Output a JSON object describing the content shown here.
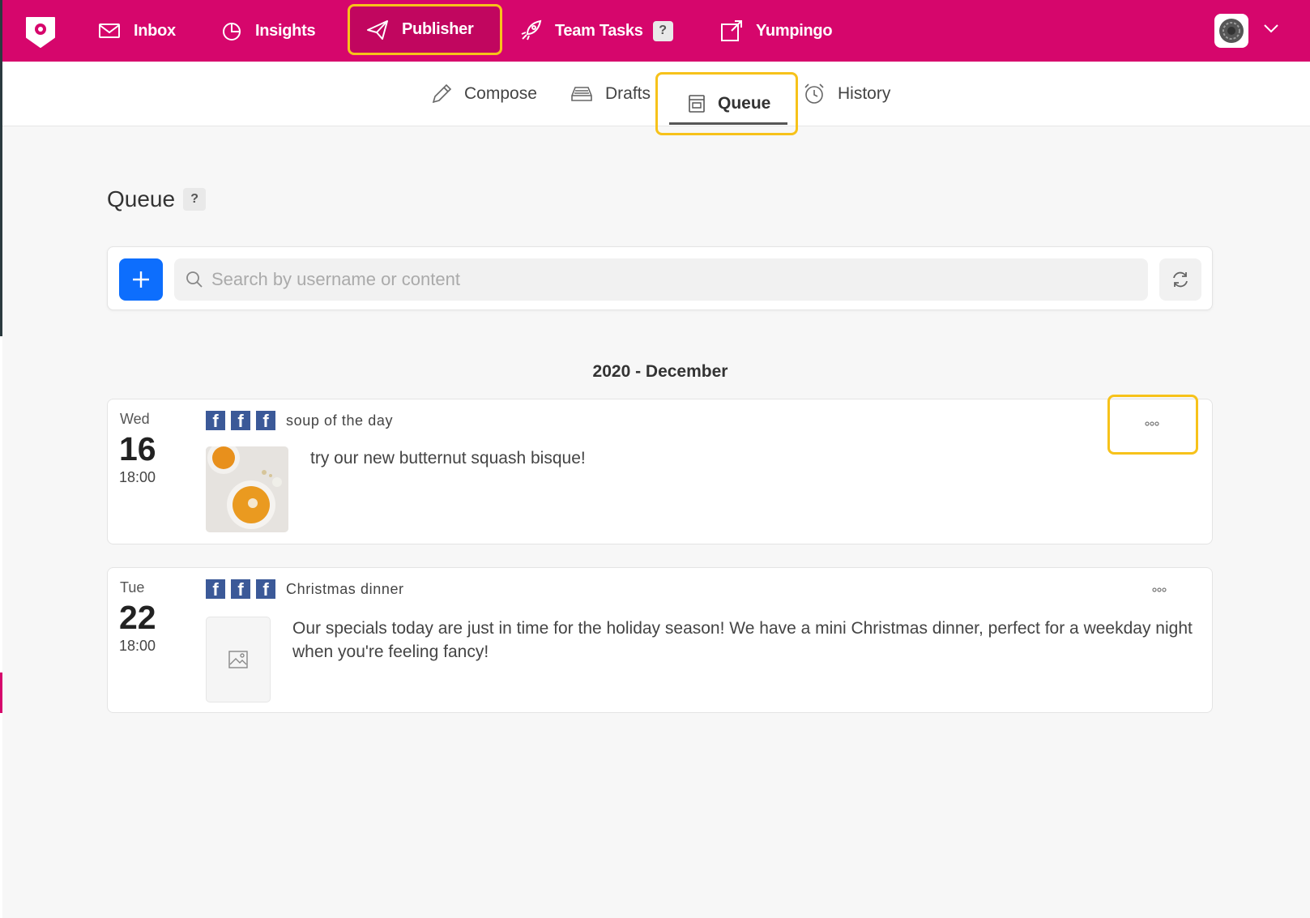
{
  "nav": {
    "items": [
      {
        "label": "Inbox",
        "icon": "mail-icon"
      },
      {
        "label": "Insights",
        "icon": "pie-chart-icon"
      },
      {
        "label": "Publisher",
        "icon": "paper-plane-icon",
        "active": true
      },
      {
        "label": "Team Tasks",
        "icon": "rocket-icon",
        "badge": "?"
      },
      {
        "label": "Yumpingo",
        "icon": "external-link-icon"
      }
    ]
  },
  "subnav": {
    "items": [
      {
        "label": "Compose",
        "icon": "pencil-icon"
      },
      {
        "label": "Drafts",
        "icon": "tray-icon"
      },
      {
        "label": "Queue",
        "icon": "calendar-icon",
        "active": true
      },
      {
        "label": "History",
        "icon": "alarm-clock-icon"
      }
    ]
  },
  "page": {
    "title": "Queue",
    "help": "?"
  },
  "search": {
    "placeholder": "Search by username or content",
    "value": ""
  },
  "queue": {
    "month_header": "2020 - December",
    "posts": [
      {
        "day": "Wed",
        "date": "16",
        "time": "18:00",
        "networks": [
          "facebook",
          "facebook",
          "facebook"
        ],
        "title": "soup of the day",
        "text": "try our new butternut squash bisque!",
        "has_image": true
      },
      {
        "day": "Tue",
        "date": "22",
        "time": "18:00",
        "networks": [
          "facebook",
          "facebook",
          "facebook"
        ],
        "title": "Christmas dinner",
        "text": "Our specials today are just in time for the holiday season! We have a mini Christmas dinner, perfect for a weekday night when you're feeling fancy!",
        "has_image": false
      }
    ]
  },
  "colors": {
    "brand": "#d6066c",
    "highlight": "#f7c21a",
    "primary_button": "#0d6efd",
    "facebook": "#3b5998"
  },
  "fb_glyph": "f"
}
